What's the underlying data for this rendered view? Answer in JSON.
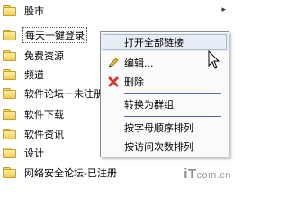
{
  "folders": [
    {
      "label": "股市",
      "has_arrow": true
    },
    {
      "label": "每天一键登录"
    },
    {
      "label": "免费资源"
    },
    {
      "label": "频道"
    },
    {
      "label": "软件论坛－未注册"
    },
    {
      "label": "软件下载"
    },
    {
      "label": "软件资讯"
    },
    {
      "label": "设计"
    },
    {
      "label": "网络安全论坛-已注册"
    }
  ],
  "arrow_glyph": "▸",
  "context_menu": {
    "open_all": "打开全部链接",
    "edit": "编辑...",
    "delete": "删除",
    "convert_group": "转换为群组",
    "sort_alpha": "按字母顺序排列",
    "sort_visits": "按访问次数排列"
  },
  "watermark": {
    "brand": "iT",
    "rest": "com.cn"
  },
  "colors": {
    "separator": "#4a6db3",
    "delete_icon": "#d9372b",
    "highlight": "#e8eef7"
  }
}
